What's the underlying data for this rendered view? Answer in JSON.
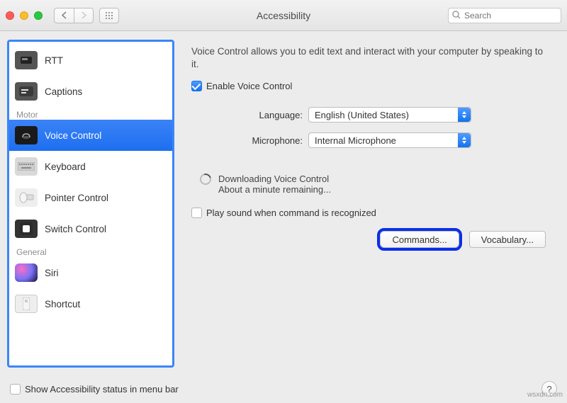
{
  "titlebar": {
    "title": "Accessibility",
    "search_placeholder": "Search"
  },
  "sidebar": {
    "header_motor": "Motor",
    "header_general": "General",
    "items": {
      "rtt": "RTT",
      "captions": "Captions",
      "voice_control": "Voice Control",
      "keyboard": "Keyboard",
      "pointer_control": "Pointer Control",
      "switch_control": "Switch Control",
      "siri": "Siri",
      "shortcut": "Shortcut"
    }
  },
  "panel": {
    "description": "Voice Control allows you to edit text and interact with your computer by speaking to it.",
    "enable_label": "Enable Voice Control",
    "language_label": "Language:",
    "language_value": "English (United States)",
    "microphone_label": "Microphone:",
    "microphone_value": "Internal Microphone",
    "download_title": "Downloading Voice Control",
    "download_status": "About a minute remaining...",
    "play_sound_label": "Play sound when command is recognized",
    "commands_button": "Commands...",
    "vocabulary_button": "Vocabulary..."
  },
  "footer": {
    "menubar_label": "Show Accessibility status in menu bar",
    "help_label": "?"
  },
  "watermark": "wsxdn.com"
}
